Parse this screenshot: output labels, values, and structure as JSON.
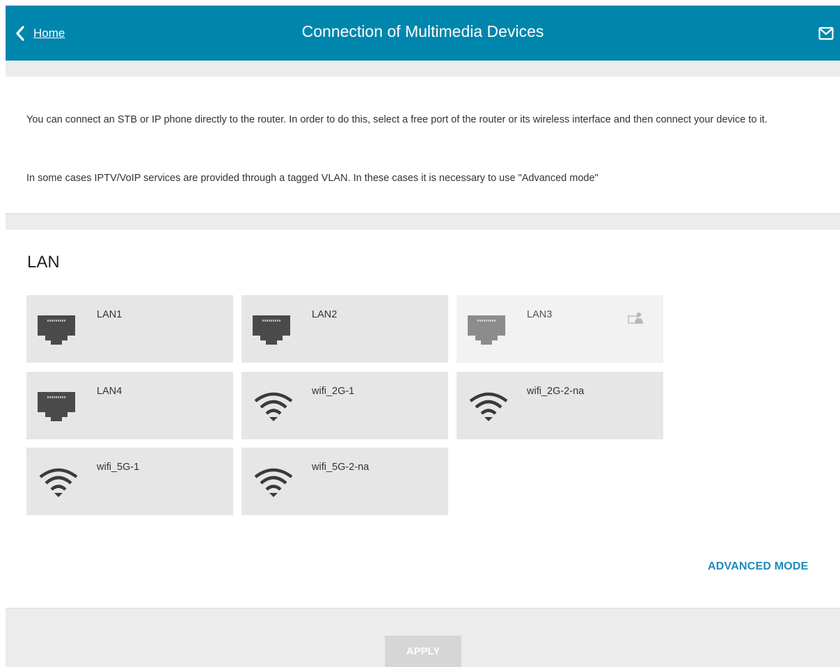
{
  "header": {
    "back_label": "Home",
    "title": "Connection of Multimedia Devices",
    "mail_icon": "mail-icon",
    "back_icon": "chevron-left-icon"
  },
  "info": {
    "paragraph1": "You can connect an STB or IP phone directly to the router. In order to do this, select a free port of the router or its wireless interface and then connect your device to it.",
    "paragraph2": "In some cases IPTV/VoIP services are provided through a tagged VLAN. In these cases it is necessary to use \"Advanced mode\""
  },
  "lan": {
    "title": "LAN",
    "ports": [
      {
        "label": "LAN1",
        "type": "ethernet",
        "icon": "ethernet-port-icon",
        "disabled": false
      },
      {
        "label": "LAN2",
        "type": "ethernet",
        "icon": "ethernet-port-icon",
        "disabled": false
      },
      {
        "label": "LAN3",
        "type": "ethernet",
        "icon": "ethernet-port-icon",
        "disabled": true,
        "badge_icon": "connected-device-icon"
      },
      {
        "label": "LAN4",
        "type": "ethernet",
        "icon": "ethernet-port-icon",
        "disabled": false
      },
      {
        "label": "wifi_2G-1",
        "type": "wifi",
        "icon": "wifi-icon",
        "disabled": false
      },
      {
        "label": "wifi_2G-2-na",
        "type": "wifi",
        "icon": "wifi-icon",
        "disabled": false
      },
      {
        "label": "wifi_5G-1",
        "type": "wifi",
        "icon": "wifi-icon",
        "disabled": false
      },
      {
        "label": "wifi_5G-2-na",
        "type": "wifi",
        "icon": "wifi-icon",
        "disabled": false
      }
    ],
    "advanced_mode_label": "ADVANCED MODE"
  },
  "footer": {
    "apply_label": "APPLY",
    "apply_enabled": false
  },
  "colors": {
    "header_bg": "#0086ad",
    "link_accent": "#1c8bbc",
    "icon_dark": "#4a4a4a",
    "icon_disabled": "#8c8c8c",
    "tile_bg": "#e6e6e6",
    "tile_disabled_bg": "#f2f2f2",
    "apply_disabled_bg": "#d6d6d6"
  }
}
